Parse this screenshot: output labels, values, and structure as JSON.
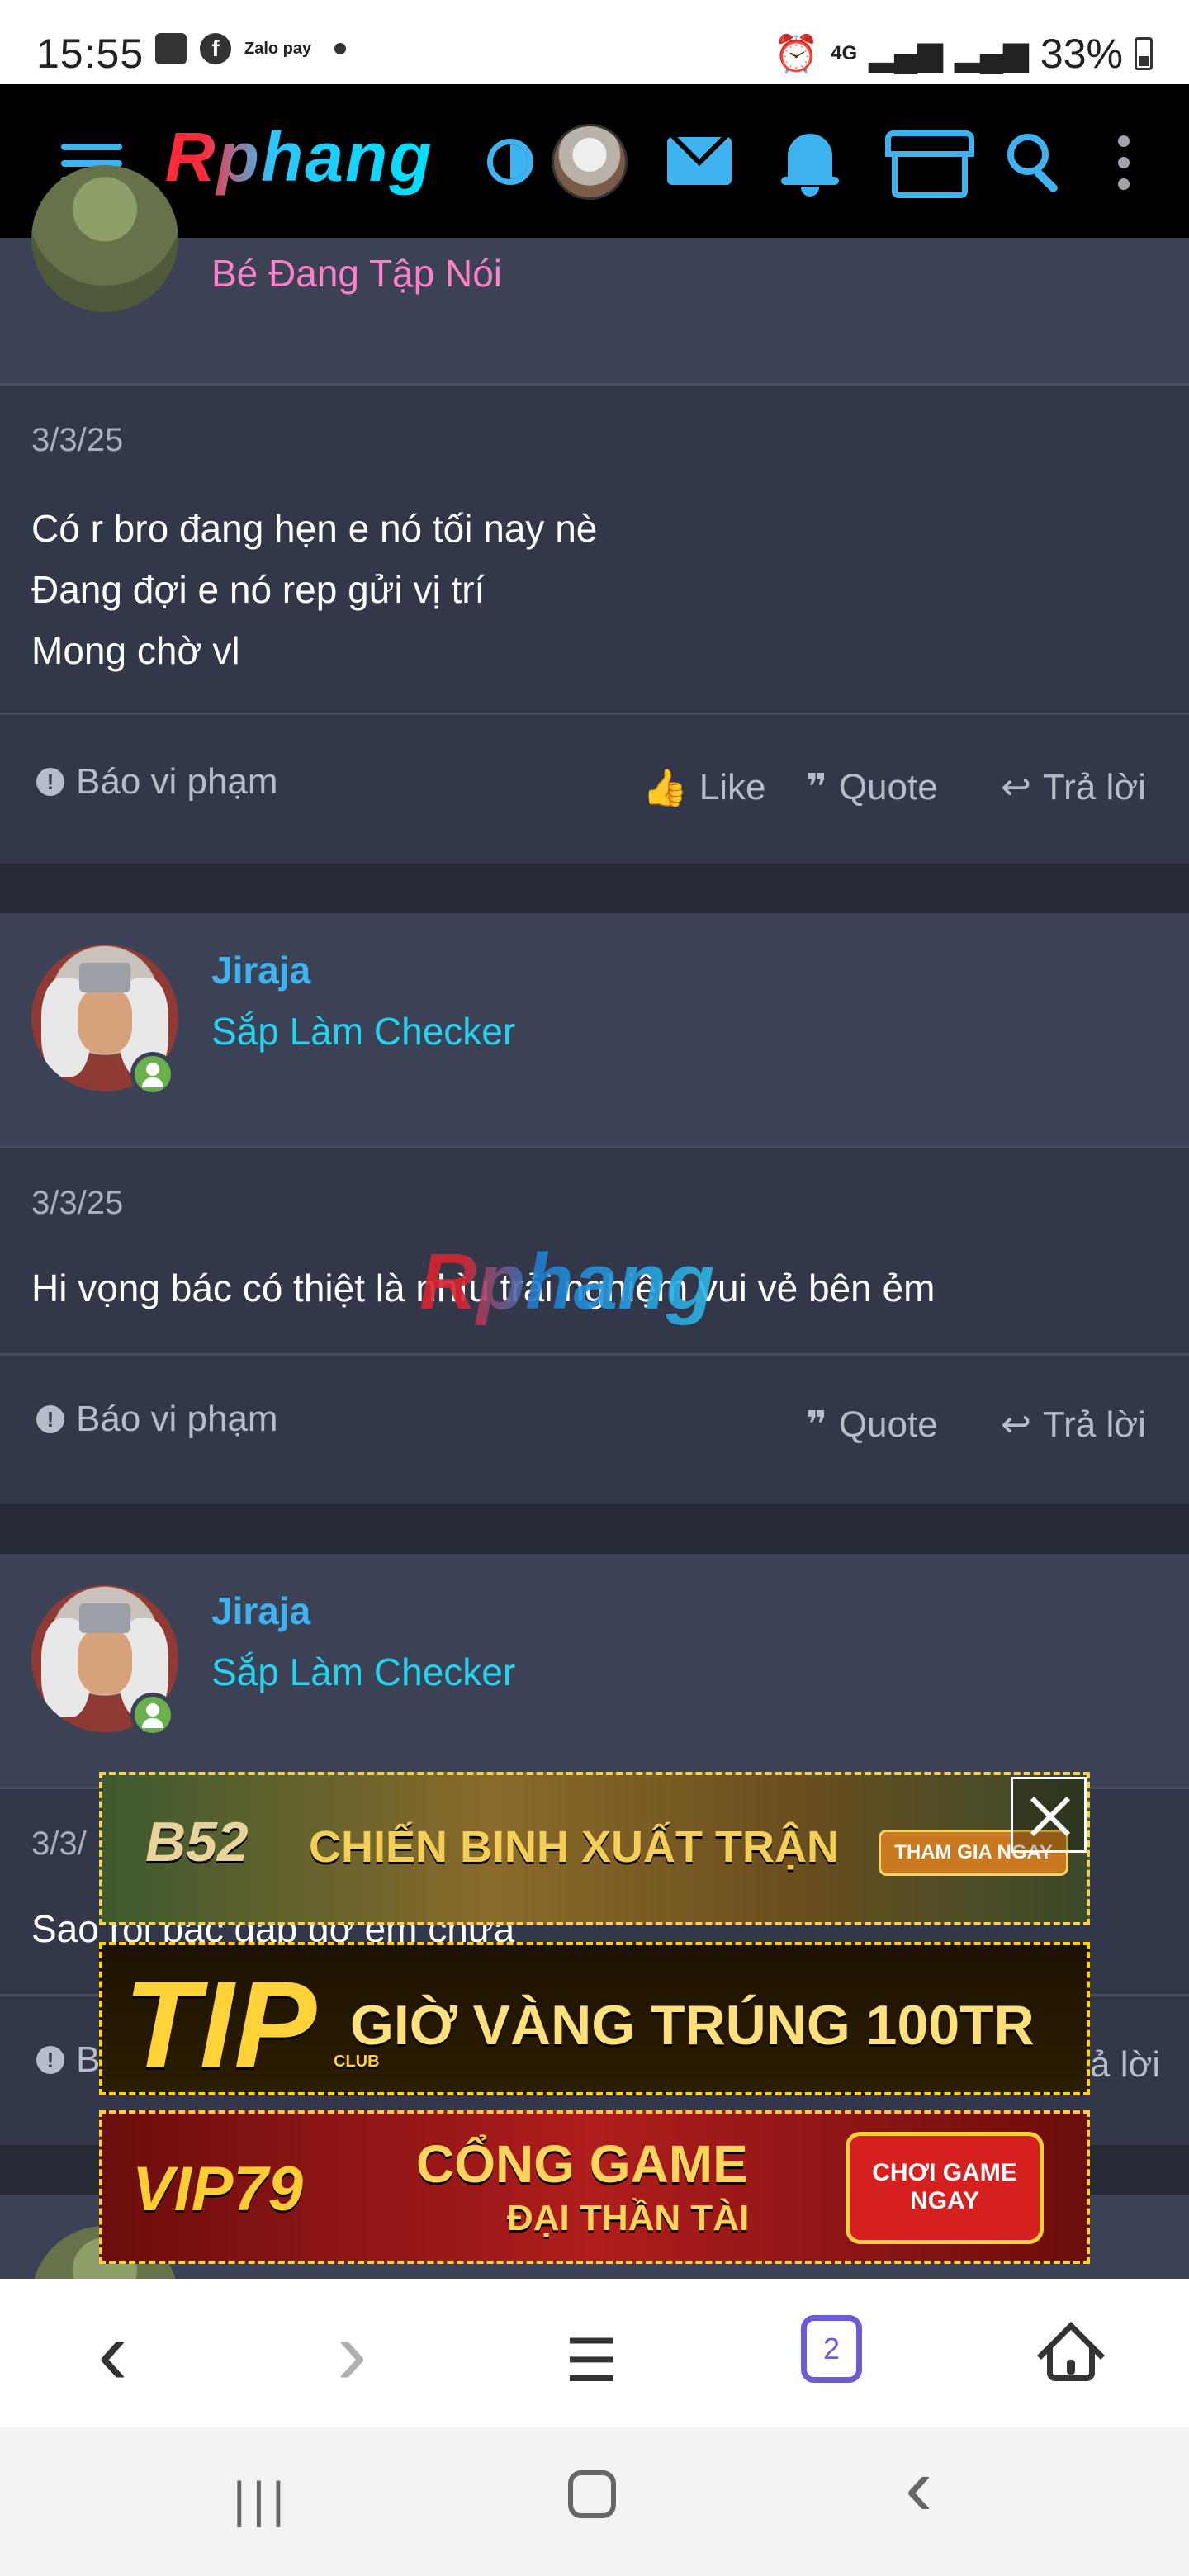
{
  "status_bar": {
    "time": "15:55",
    "zalo": "Zalo pay",
    "network": "4G",
    "battery": "33%"
  },
  "app_bar": {
    "logo": "Rphang"
  },
  "posts": [
    {
      "rank": "Bé Đang Tập Nói",
      "date": "3/3/25",
      "message_lines": [
        "Có r bro đang hẹn e nó tối nay nè",
        "Đang đợi e nó rep gửi vị trí",
        "Mong chờ vl"
      ]
    },
    {
      "username": "Jiraja",
      "rank": "Sắp Làm Checker",
      "date": "3/3/25",
      "message_lines": [
        "Hi vọng bác có thiệt là nhìu trải nghiệm vui vẻ bên ẻm"
      ]
    },
    {
      "username": "Jiraja",
      "rank": "Sắp Làm Checker",
      "date": "3/3/",
      "message_lines": [
        "Sao rồi bác gặp gỡ em chưa"
      ]
    }
  ],
  "actions": {
    "report": "Báo vi phạm",
    "like": "Like",
    "quote": "Quote",
    "reply": "Trả lời",
    "reply_partial": "ả lời",
    "report_partial": "B"
  },
  "watermark": "Rphang",
  "ads": {
    "ad1": {
      "badge": "B52",
      "text": "CHIẾN BINH XUẤT TRẬN",
      "cta": "THAM GIA NGAY"
    },
    "ad2": {
      "brand": "TIP",
      "brand_sub": "CLUB",
      "text": "GIỜ VÀNG TRÚNG 100TR"
    },
    "ad3": {
      "brand": "VIP79",
      "text_top": "CỔNG GAME",
      "text_bottom": "ĐẠI THẦN TÀI",
      "cta_top": "CHƠI GAME",
      "cta_bottom": "NGAY"
    }
  },
  "browser_nav": {
    "back": "‹",
    "forward": "›",
    "menu": "☰",
    "tab_count": "2"
  },
  "system_nav": {
    "recents": "|||",
    "home": "○",
    "back": "‹"
  }
}
